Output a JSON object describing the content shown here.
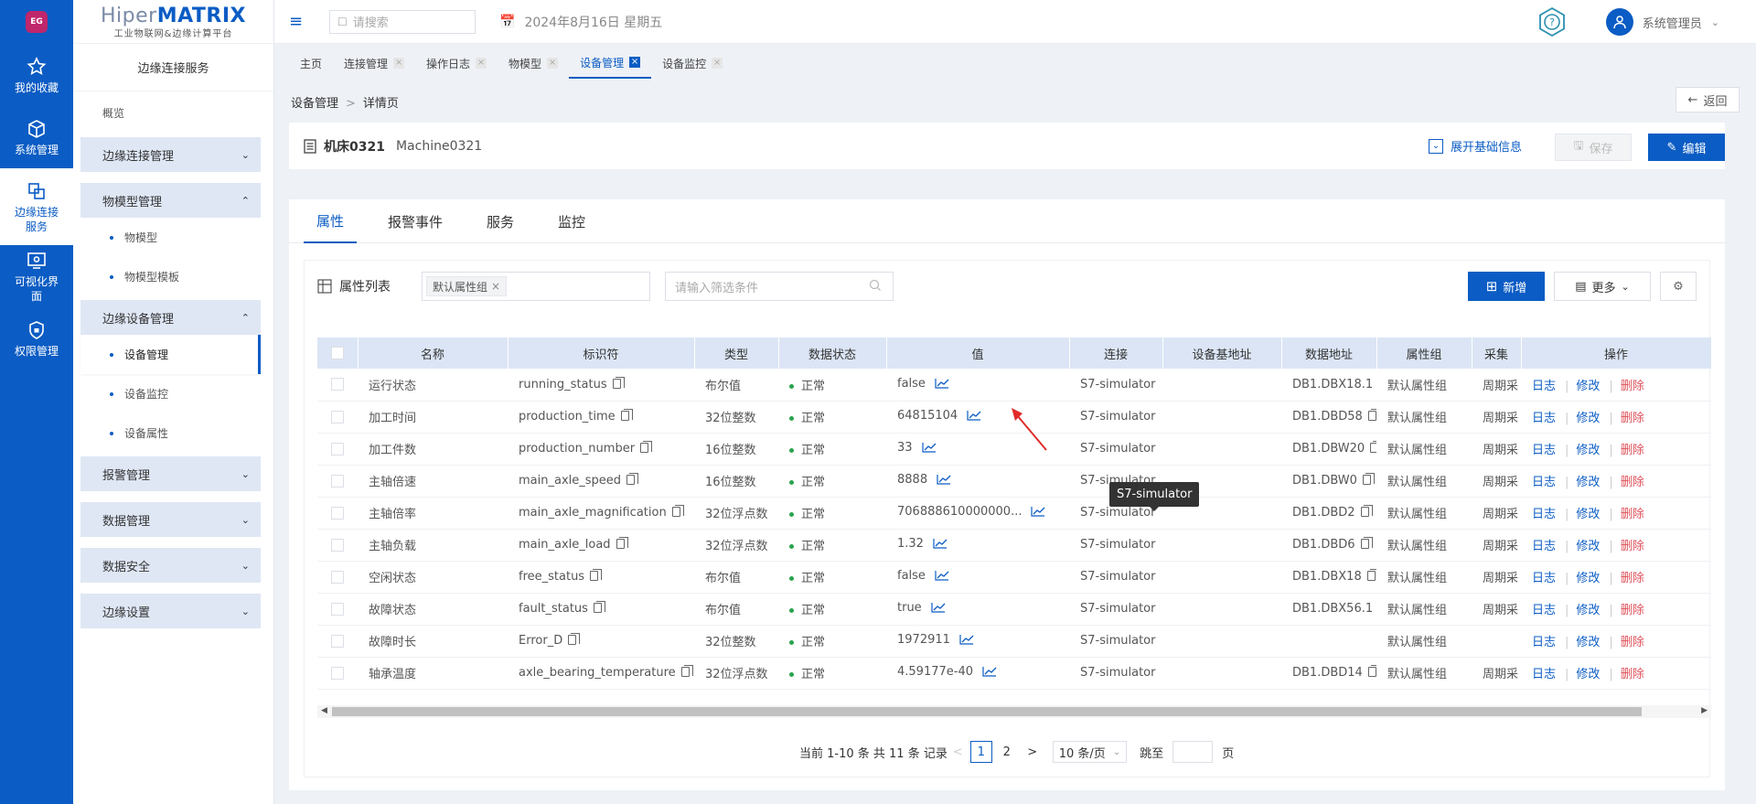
{
  "rail": {
    "logo_text": "EG",
    "items": [
      {
        "label": "我的收藏"
      },
      {
        "label": "系统管理"
      },
      {
        "label": "边缘连接服务"
      },
      {
        "label": "可视化界面"
      },
      {
        "label": "权限管理"
      }
    ]
  },
  "brand": {
    "name_prefix": "Hiper",
    "name_suffix": "MATRIX",
    "tagline": "工业物联网&边缘计算平台"
  },
  "sidebar": {
    "title": "边缘连接服务",
    "overview": "概览",
    "groups": [
      {
        "label": "边缘连接管理"
      },
      {
        "label": "物模型管理",
        "subs": [
          "物模型",
          "物模型模板"
        ]
      },
      {
        "label": "边缘设备管理",
        "subs": [
          "设备管理",
          "设备监控",
          "设备属性"
        ]
      },
      {
        "label": "报警管理"
      },
      {
        "label": "数据管理"
      },
      {
        "label": "数据安全"
      },
      {
        "label": "边缘设置"
      }
    ]
  },
  "topbar": {
    "search_placeholder": "请搜索",
    "date": "2024年8月16日 星期五",
    "user": "系统管理员"
  },
  "tabs": [
    "主页",
    "连接管理",
    "操作日志",
    "物模型",
    "设备管理",
    "设备监控"
  ],
  "breadcrumb": {
    "parent": "设备管理",
    "sep": ">",
    "current": "详情页"
  },
  "back_label": "返回",
  "machine": {
    "name": "机床0321",
    "code": "Machine0321",
    "expand_label": "展开基础信息",
    "save_label": "保存",
    "edit_label": "编辑"
  },
  "content_tabs": [
    "属性",
    "报警事件",
    "服务",
    "监控"
  ],
  "toolbar": {
    "list_title": "属性列表",
    "group_chip": "默认属性组",
    "filter_placeholder": "请输入筛选条件",
    "add_label": "新增",
    "more_label": "更多"
  },
  "table": {
    "headers": [
      "名称",
      "标识符",
      "类型",
      "数据状态",
      "值",
      "连接",
      "设备基地址",
      "数据地址",
      "属性组",
      "采集",
      "操作"
    ],
    "rows": [
      {
        "name": "运行状态",
        "id": "running_status",
        "type": "布尔值",
        "status": "正常",
        "value": "false",
        "conn": "S7-simulator",
        "base": "",
        "addr": "DB1.DBX18.1",
        "group": "默认属性组",
        "collect": "周期采"
      },
      {
        "name": "加工时间",
        "id": "production_time",
        "type": "32位整数",
        "status": "正常",
        "value": "64815104",
        "conn": "S7-simulator",
        "base": "",
        "addr": "DB1.DBD58",
        "group": "默认属性组",
        "collect": "周期采"
      },
      {
        "name": "加工件数",
        "id": "production_number",
        "type": "16位整数",
        "status": "正常",
        "value": "33",
        "conn": "S7-simulator",
        "base": "",
        "addr": "DB1.DBW20",
        "group": "默认属性组",
        "collect": "周期采"
      },
      {
        "name": "主轴倍速",
        "id": "main_axle_speed",
        "type": "16位整数",
        "status": "正常",
        "value": "8888",
        "conn": "S7-simulator",
        "base": "",
        "addr": "DB1.DBW0",
        "group": "默认属性组",
        "collect": "周期采"
      },
      {
        "name": "主轴倍率",
        "id": "main_axle_magnification",
        "type": "32位浮点数",
        "status": "正常",
        "value": "706888610000000...",
        "conn": "S7-simulator",
        "base": "",
        "addr": "DB1.DBD2",
        "group": "默认属性组",
        "collect": "周期采"
      },
      {
        "name": "主轴负载",
        "id": "main_axle_load",
        "type": "32位浮点数",
        "status": "正常",
        "value": "1.32",
        "conn": "S7-simulator",
        "base": "",
        "addr": "DB1.DBD6",
        "group": "默认属性组",
        "collect": "周期采"
      },
      {
        "name": "空闲状态",
        "id": "free_status",
        "type": "布尔值",
        "status": "正常",
        "value": "false",
        "conn": "S7-simulator",
        "base": "",
        "addr": "DB1.DBX18",
        "group": "默认属性组",
        "collect": "周期采"
      },
      {
        "name": "故障状态",
        "id": "fault_status",
        "type": "布尔值",
        "status": "正常",
        "value": "true",
        "conn": "S7-simulator",
        "base": "",
        "addr": "DB1.DBX56.1",
        "group": "默认属性组",
        "collect": "周期采"
      },
      {
        "name": "故障时长",
        "id": "Error_D",
        "type": "32位整数",
        "status": "正常",
        "value": "1972911",
        "conn": "S7-simulator",
        "base": "",
        "addr": "",
        "group": "默认属性组",
        "collect": ""
      },
      {
        "name": "轴承温度",
        "id": "axle_bearing_temperature",
        "type": "32位浮点数",
        "status": "正常",
        "value": "4.59177e-40",
        "conn": "S7-simulator",
        "base": "",
        "addr": "DB1.DBD14",
        "group": "默认属性组",
        "collect": "周期采"
      }
    ],
    "ops": {
      "log": "日志",
      "modify": "修改",
      "delete": "删除"
    }
  },
  "tooltip": "S7-simulator",
  "pager": {
    "summary": "当前 1-10 条 共 11 条 记录",
    "pages": [
      "1",
      "2"
    ],
    "page_size": "10 条/页",
    "jump_label": "跳至",
    "page_unit": "页"
  },
  "colors": {
    "primary": "#0b5cc4",
    "danger": "#e0505a",
    "ok": "#2aa44f",
    "header_bg": "#dbe5f5"
  }
}
